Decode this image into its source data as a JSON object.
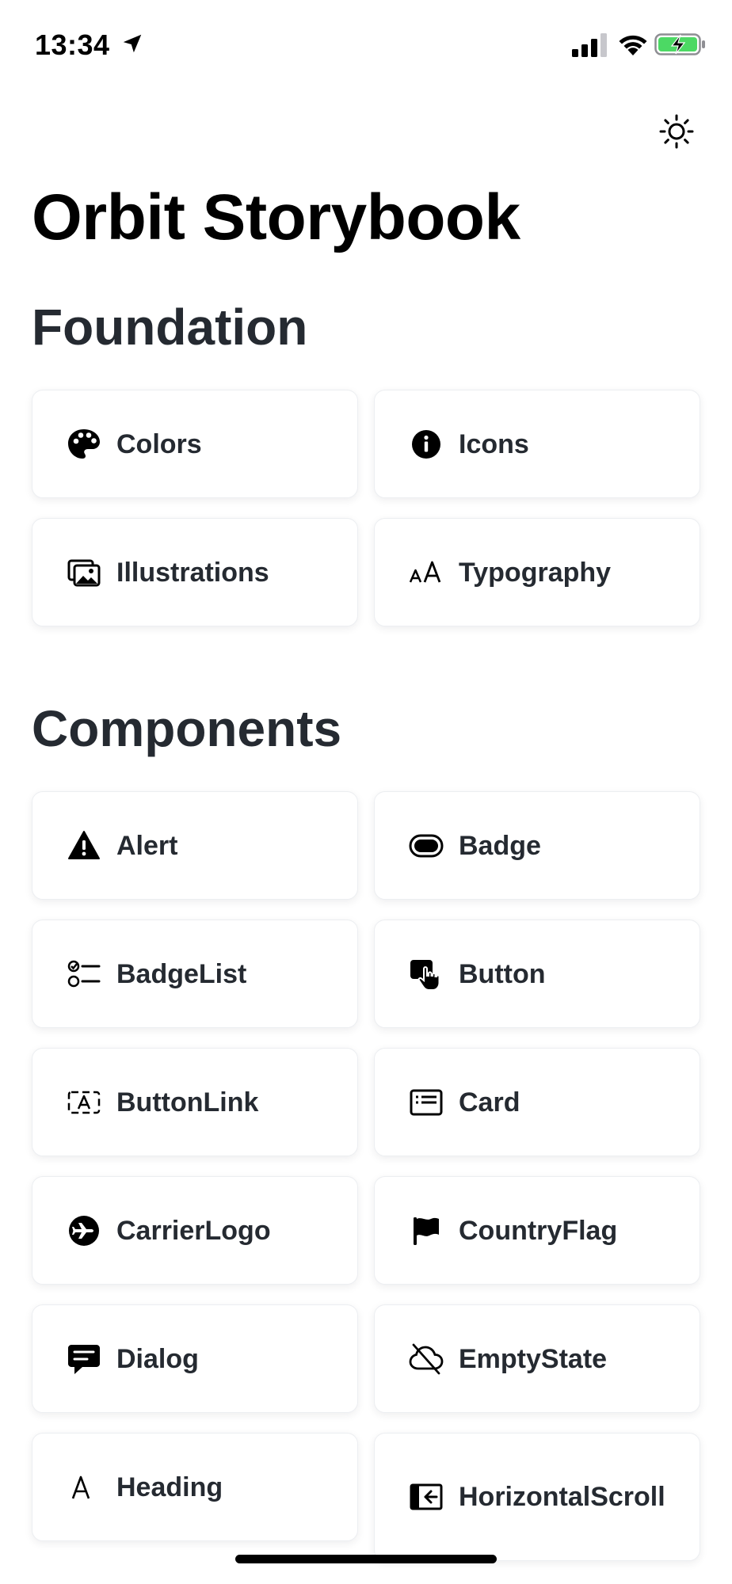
{
  "status_bar": {
    "time": "13:34"
  },
  "header": {
    "title": "Orbit Storybook",
    "theme_icon": "sun-icon"
  },
  "sections": {
    "foundation": {
      "title": "Foundation",
      "items": [
        {
          "label": "Colors",
          "icon": "palette-icon"
        },
        {
          "label": "Icons",
          "icon": "info-icon"
        },
        {
          "label": "Illustrations",
          "icon": "images-icon"
        },
        {
          "label": "Typography",
          "icon": "typography-icon"
        }
      ]
    },
    "components": {
      "title": "Components",
      "items": [
        {
          "label": "Alert",
          "icon": "warning-icon"
        },
        {
          "label": "Badge",
          "icon": "badge-icon"
        },
        {
          "label": "BadgeList",
          "icon": "checklist-icon"
        },
        {
          "label": "Button",
          "icon": "hand-tap-icon"
        },
        {
          "label": "ButtonLink",
          "icon": "text-box-icon"
        },
        {
          "label": "Card",
          "icon": "card-icon"
        },
        {
          "label": "CarrierLogo",
          "icon": "airplane-icon"
        },
        {
          "label": "CountryFlag",
          "icon": "flag-icon"
        },
        {
          "label": "Dialog",
          "icon": "chat-icon"
        },
        {
          "label": "EmptyState",
          "icon": "cloud-off-icon"
        },
        {
          "label": "Heading",
          "icon": "heading-icon"
        },
        {
          "label": "HorizontalScroll",
          "icon": "scroll-icon"
        }
      ]
    }
  },
  "colors": {
    "text_primary": "#252a31",
    "battery_green": "#4cd964",
    "tile_border": "#eceef1"
  }
}
